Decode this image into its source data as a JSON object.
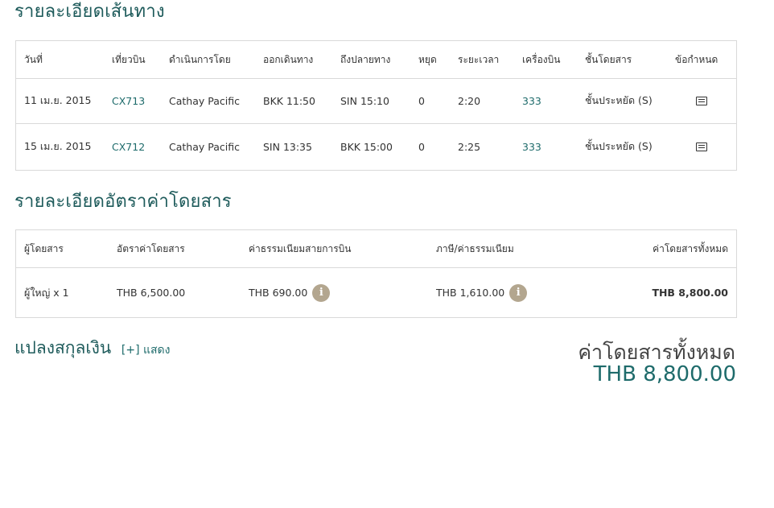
{
  "flight_section": {
    "title": "รายละเอียดเส้นทาง",
    "headers": [
      "วันที่",
      "เที่ยวบิน",
      "ดำเนินการโดย",
      "ออกเดินทาง",
      "ถึงปลายทาง",
      "หยุด",
      "ระยะเวลา",
      "เครื่องบิน",
      "ชั้นโดยสาร",
      "ข้อกำหนด"
    ],
    "rows": [
      {
        "date": "11 เม.ย. 2015",
        "flight": "CX713",
        "operator": "Cathay Pacific",
        "depart": "BKK 11:50",
        "arrive": "SIN 15:10",
        "stops": "0",
        "duration": "2:20",
        "aircraft": "333",
        "cabin": "ชั้นประหยัด (S)",
        "rules_icon": "document-icon"
      },
      {
        "date": "15 เม.ย. 2015",
        "flight": "CX712",
        "operator": "Cathay Pacific",
        "depart": "SIN 13:35",
        "arrive": "BKK 15:00",
        "stops": "0",
        "duration": "2:25",
        "aircraft": "333",
        "cabin": "ชั้นประหยัด (S)",
        "rules_icon": "document-icon"
      }
    ]
  },
  "fare_section": {
    "title": "รายละเอียดอัตราค่าโดยสาร",
    "headers": [
      "ผู้โดยสาร",
      "อัตราค่าโดยสาร",
      "ค่าธรรมเนียมสายการบิน",
      "ภาษี/ค่าธรรมเนียม",
      "ค่าโดยสารทั้งหมด"
    ],
    "rows": [
      {
        "passenger": "ผู้ใหญ่ x 1",
        "fare": "THB 6,500.00",
        "carrier_fee": "THB 690.00",
        "tax": "THB 1,610.00",
        "total": "THB 8,800.00",
        "info_icon": "info-icon",
        "info_glyph": "i"
      }
    ]
  },
  "currency": {
    "label": "แปลงสกุลเงิน",
    "toggle": "[+] แสดง"
  },
  "total": {
    "label": "ค่าโดยสารทั้งหมด",
    "value": "THB 8,800.00"
  },
  "colors": {
    "accent": "#1e5b5b",
    "link": "#1e6b6b",
    "info_badge": "#b3a68f",
    "border": "#d9d9d9"
  }
}
